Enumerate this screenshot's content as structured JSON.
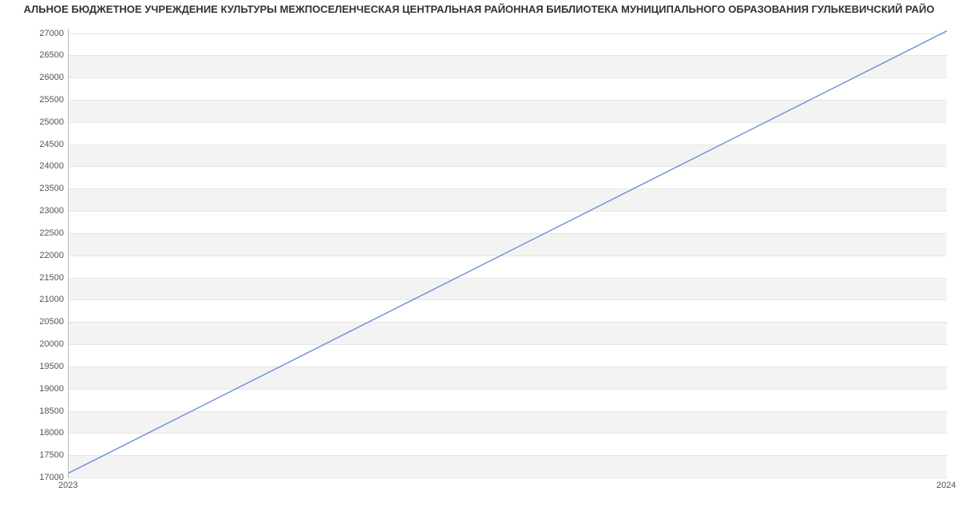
{
  "chart_data": {
    "type": "line",
    "title": "АЛЬНОЕ БЮДЖЕТНОЕ УЧРЕЖДЕНИЕ КУЛЬТУРЫ МЕЖПОСЕЛЕНЧЕСКАЯ ЦЕНТРАЛЬНАЯ РАЙОННАЯ БИБЛИОТЕКА МУНИЦИПАЛЬНОГО ОБРАЗОВАНИЯ ГУЛЬКЕВИЧСКИЙ РАЙО",
    "x": [
      2023,
      2024
    ],
    "values": [
      17100,
      27050
    ],
    "xlabel": "",
    "ylabel": "",
    "ylim": [
      17000,
      27100
    ],
    "y_ticks": [
      17000,
      17500,
      18000,
      18500,
      19000,
      19500,
      20000,
      20500,
      21000,
      21500,
      22000,
      22500,
      23000,
      23500,
      24000,
      24500,
      25000,
      25500,
      26000,
      26500,
      27000
    ],
    "x_ticks": [
      "2023",
      "2024"
    ],
    "line_color": "#6a8fd8"
  }
}
